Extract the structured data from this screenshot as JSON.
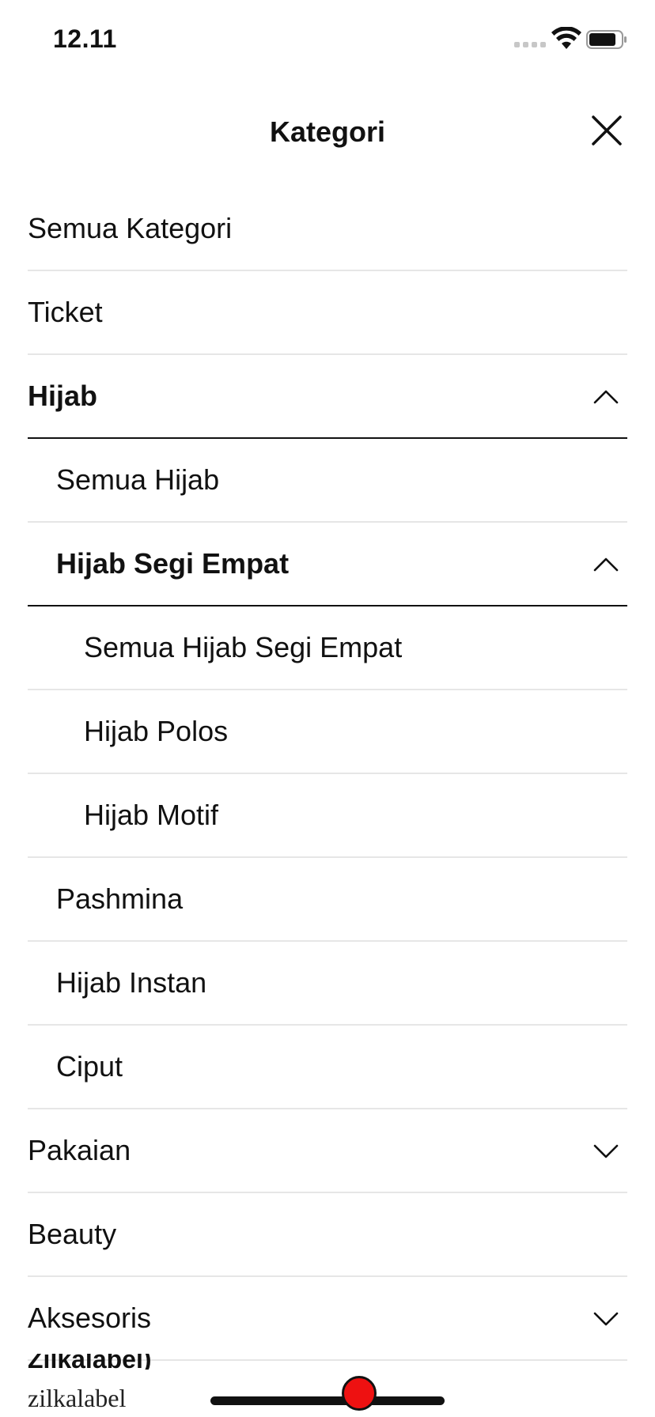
{
  "status_bar": {
    "time": "12.11",
    "signal_icon": "signal-dots-icon",
    "wifi_icon": "wifi-icon",
    "battery_icon": "battery-icon"
  },
  "header": {
    "title": "Kategori",
    "close_icon": "close-icon"
  },
  "categories": [
    {
      "label": "Semua Kategori",
      "level": 1,
      "expanded": false,
      "chevron": null
    },
    {
      "label": "Ticket",
      "level": 1,
      "expanded": false,
      "chevron": null
    },
    {
      "label": "Hijab",
      "level": 1,
      "expanded": true,
      "chevron": "up"
    },
    {
      "label": "Semua Hijab",
      "level": 2,
      "expanded": false,
      "chevron": null
    },
    {
      "label": "Hijab Segi Empat",
      "level": 2,
      "expanded": true,
      "chevron": "up"
    },
    {
      "label": "Semua Hijab Segi Empat",
      "level": 3,
      "expanded": false,
      "chevron": null
    },
    {
      "label": "Hijab Polos",
      "level": 3,
      "expanded": false,
      "chevron": null
    },
    {
      "label": "Hijab Motif",
      "level": 3,
      "expanded": false,
      "chevron": null
    },
    {
      "label": "Pashmina",
      "level": 2,
      "expanded": false,
      "chevron": null
    },
    {
      "label": "Hijab Instan",
      "level": 2,
      "expanded": false,
      "chevron": null
    },
    {
      "label": "Ciput",
      "level": 2,
      "expanded": false,
      "chevron": null
    },
    {
      "label": "Pakaian",
      "level": 1,
      "expanded": false,
      "chevron": "down"
    },
    {
      "label": "Beauty",
      "level": 1,
      "expanded": false,
      "chevron": null
    },
    {
      "label": "Aksesoris",
      "level": 1,
      "expanded": false,
      "chevron": "down"
    }
  ],
  "footer": {
    "partial_text": "Zilkalabel)",
    "brand": "zilkalabel"
  },
  "colors": {
    "text": "#111111",
    "divider": "#e6e6e6",
    "active_divider": "#111111",
    "record": "#ee1111"
  }
}
